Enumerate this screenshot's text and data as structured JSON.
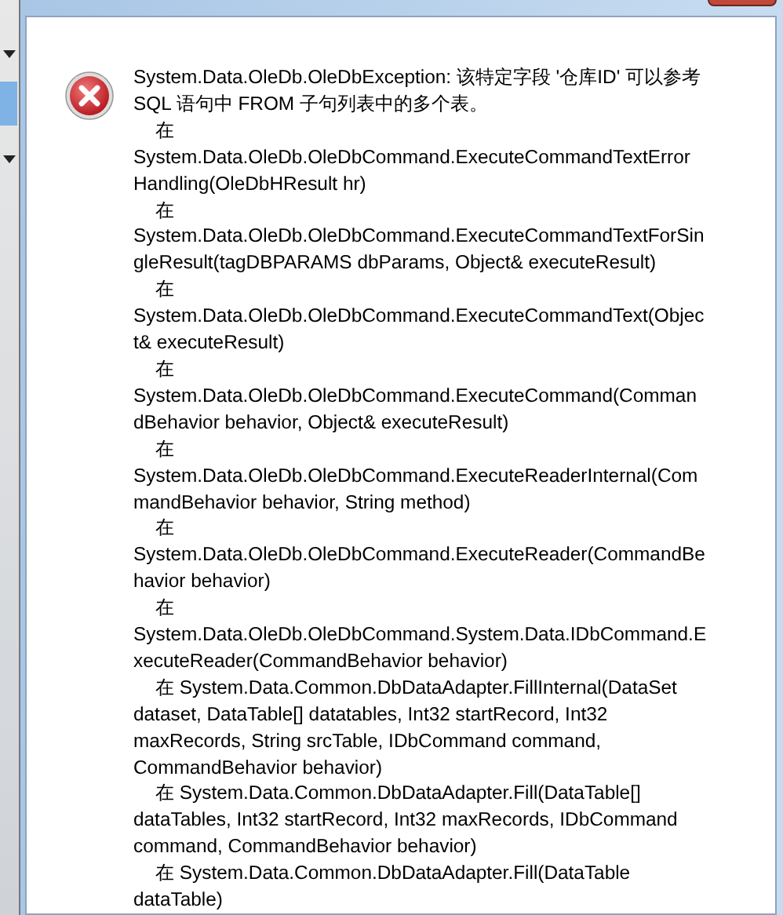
{
  "dialog": {
    "message_lines": [
      {
        "text": "System.Data.OleDb.OleDbException: 该特定字段 '仓库ID' 可以参考",
        "indent": false
      },
      {
        "text": "SQL 语句中 FROM 子句列表中的多个表。",
        "indent": false
      },
      {
        "text": "在",
        "indent": true
      },
      {
        "text": "System.Data.OleDb.OleDbCommand.ExecuteCommandTextError",
        "indent": false
      },
      {
        "text": "Handling(OleDbHResult hr)",
        "indent": false
      },
      {
        "text": "在",
        "indent": true
      },
      {
        "text": "System.Data.OleDb.OleDbCommand.ExecuteCommandTextForSin",
        "indent": false
      },
      {
        "text": "gleResult(tagDBPARAMS dbParams, Object& executeResult)",
        "indent": false
      },
      {
        "text": "在",
        "indent": true
      },
      {
        "text": "System.Data.OleDb.OleDbCommand.ExecuteCommandText(Objec",
        "indent": false
      },
      {
        "text": "t& executeResult)",
        "indent": false
      },
      {
        "text": "在",
        "indent": true
      },
      {
        "text": "System.Data.OleDb.OleDbCommand.ExecuteCommand(Comman",
        "indent": false
      },
      {
        "text": "dBehavior behavior, Object& executeResult)",
        "indent": false
      },
      {
        "text": "在",
        "indent": true
      },
      {
        "text": "System.Data.OleDb.OleDbCommand.ExecuteReaderInternal(Com",
        "indent": false
      },
      {
        "text": "mandBehavior behavior, String method)",
        "indent": false
      },
      {
        "text": "在",
        "indent": true
      },
      {
        "text": "System.Data.OleDb.OleDbCommand.ExecuteReader(CommandBe",
        "indent": false
      },
      {
        "text": "havior behavior)",
        "indent": false
      },
      {
        "text": "在",
        "indent": true
      },
      {
        "text": "System.Data.OleDb.OleDbCommand.System.Data.IDbCommand.E",
        "indent": false
      },
      {
        "text": "xecuteReader(CommandBehavior behavior)",
        "indent": false
      },
      {
        "text": "在 System.Data.Common.DbDataAdapter.FillInternal(DataSet",
        "indent": true
      },
      {
        "text": "dataset, DataTable[] datatables, Int32 startRecord, Int32",
        "indent": false
      },
      {
        "text": "maxRecords, String srcTable, IDbCommand command,",
        "indent": false
      },
      {
        "text": "CommandBehavior behavior)",
        "indent": false
      },
      {
        "text": "在 System.Data.Common.DbDataAdapter.Fill(DataTable[]",
        "indent": true
      },
      {
        "text": "dataTables, Int32 startRecord, Int32 maxRecords, IDbCommand",
        "indent": false
      },
      {
        "text": "command, CommandBehavior behavior)",
        "indent": false
      },
      {
        "text": "在 System.Data.Common.DbDataAdapter.Fill(DataTable",
        "indent": true
      },
      {
        "text": "dataTable)",
        "indent": false
      }
    ]
  }
}
